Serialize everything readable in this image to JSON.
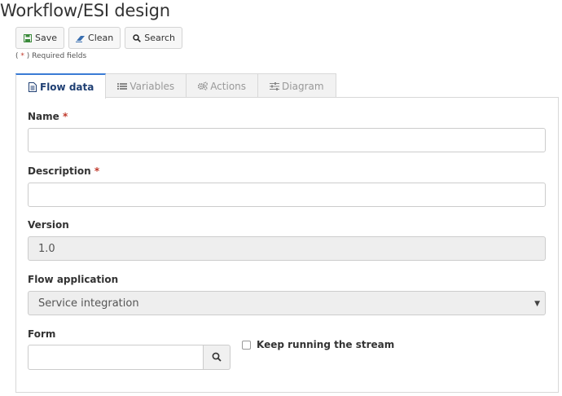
{
  "page": {
    "title": "Workflow/ESI design"
  },
  "toolbar": {
    "save": {
      "label": "Save",
      "icon": "save-icon"
    },
    "clean": {
      "label": "Clean",
      "icon": "eraser-icon"
    },
    "search": {
      "label": "Search",
      "icon": "search-icon"
    }
  },
  "required_note": {
    "prefix": "( ",
    "star": "*",
    "suffix": " ) Required fields"
  },
  "tabs": [
    {
      "label": "Flow data",
      "icon": "document-icon",
      "active": true
    },
    {
      "label": "Variables",
      "icon": "list-icon",
      "active": false
    },
    {
      "label": "Actions",
      "icon": "gears-icon",
      "active": false
    },
    {
      "label": "Diagram",
      "icon": "sliders-icon",
      "active": false
    }
  ],
  "form": {
    "name": {
      "label": "Name",
      "required_mark": "*",
      "value": ""
    },
    "description": {
      "label": "Description",
      "required_mark": "*",
      "value": ""
    },
    "version": {
      "label": "Version",
      "value": "1.0"
    },
    "flow_application": {
      "label": "Flow application",
      "value": "Service integration"
    },
    "form_field": {
      "label": "Form",
      "value": ""
    },
    "keep_running": {
      "label": "Keep running the stream",
      "checked": false
    }
  },
  "colors": {
    "accent": "#3a7bd5",
    "required": "#c0392b",
    "active_tab_text": "#1f3f73"
  }
}
